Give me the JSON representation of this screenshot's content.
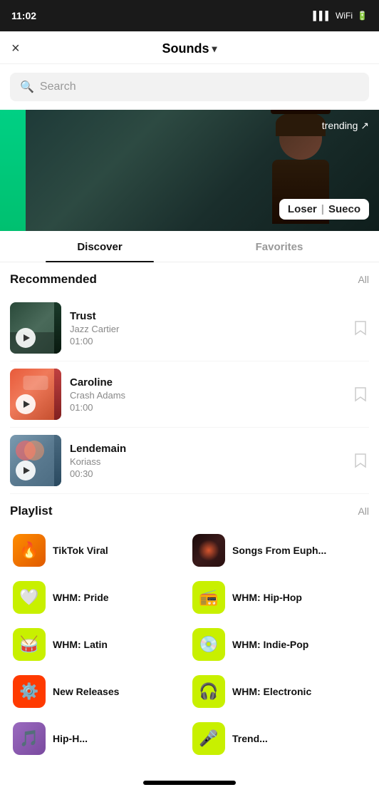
{
  "status": {
    "time": "11:02",
    "icons": [
      "signal",
      "wifi",
      "battery"
    ]
  },
  "header": {
    "title": "Sounds",
    "close_label": "×",
    "chevron": "▾"
  },
  "search": {
    "placeholder": "Search"
  },
  "hero": {
    "trending_label": "trending ↗",
    "song_label": "Loser",
    "artist_label": "Sueco"
  },
  "tabs": [
    {
      "label": "Discover",
      "active": true
    },
    {
      "label": "Favorites",
      "active": false
    }
  ],
  "recommended": {
    "title": "Recommended",
    "all_label": "All",
    "tracks": [
      {
        "name": "Trust",
        "artist": "Jazz Cartier",
        "duration": "01:00"
      },
      {
        "name": "Caroline",
        "artist": "Crash Adams",
        "duration": "01:00"
      },
      {
        "name": "Lendemain",
        "artist": "Koriass",
        "duration": "00:30"
      }
    ]
  },
  "playlist": {
    "title": "Playlist",
    "all_label": "All",
    "items": [
      {
        "name": "TikTok Viral",
        "icon": "fire",
        "style": "pi-orange"
      },
      {
        "name": "Songs From Euph...",
        "icon": "euph",
        "style": "pi-dark"
      },
      {
        "name": "WHM: Pride",
        "icon": "heart",
        "style": "pi-green"
      },
      {
        "name": "WHM: Hip-Hop",
        "icon": "radio",
        "style": "pi-green2"
      },
      {
        "name": "WHM: Latin",
        "icon": "drum",
        "style": "pi-yellow"
      },
      {
        "name": "WHM: Indie-Pop",
        "icon": "vinyl",
        "style": "pi-yellow2"
      },
      {
        "name": "New Releases",
        "icon": "gear",
        "style": "pi-red"
      },
      {
        "name": "WHM: Electronic",
        "icon": "headphones",
        "style": "pi-teal"
      }
    ]
  }
}
